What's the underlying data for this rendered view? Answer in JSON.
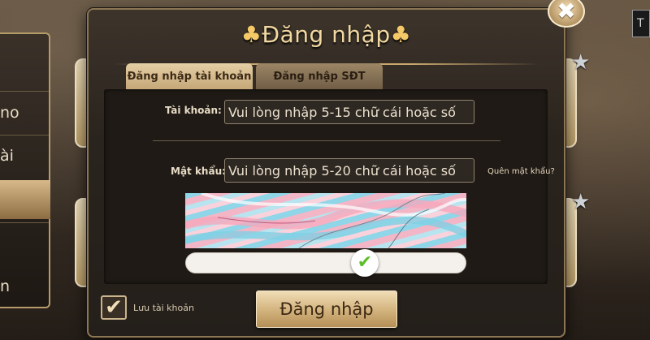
{
  "dialog": {
    "title": "Đăng nhập",
    "title_icon_left": "♣",
    "title_icon_right": "♣",
    "close_icon": "✖"
  },
  "tabs": [
    {
      "label": "Đăng nhập tài khoản",
      "active": true
    },
    {
      "label": "Đăng nhập SĐT",
      "active": false
    }
  ],
  "form": {
    "account_label": "Tài khoản:",
    "account_placeholder": "Vui lòng nhập 5-15 chữ cái hoặc số",
    "password_label": "Mật khẩu:",
    "password_placeholder": "Vui lòng nhập 5-20 chữ cái hoặc số",
    "forgot_password": "Quên mật khẩu?"
  },
  "captcha": {
    "slider_icon": "✔",
    "status_color": "#5cbf2a"
  },
  "footer": {
    "remember_checked": true,
    "remember_label": "Lưu tài khoản",
    "login_label": "Đăng nhập"
  },
  "background": {
    "side_items": [
      "no",
      "ài",
      "n"
    ],
    "topright_text": "T"
  },
  "colors": {
    "accent_gold": "#c9a86e",
    "title_text": "#f2d9a2"
  }
}
